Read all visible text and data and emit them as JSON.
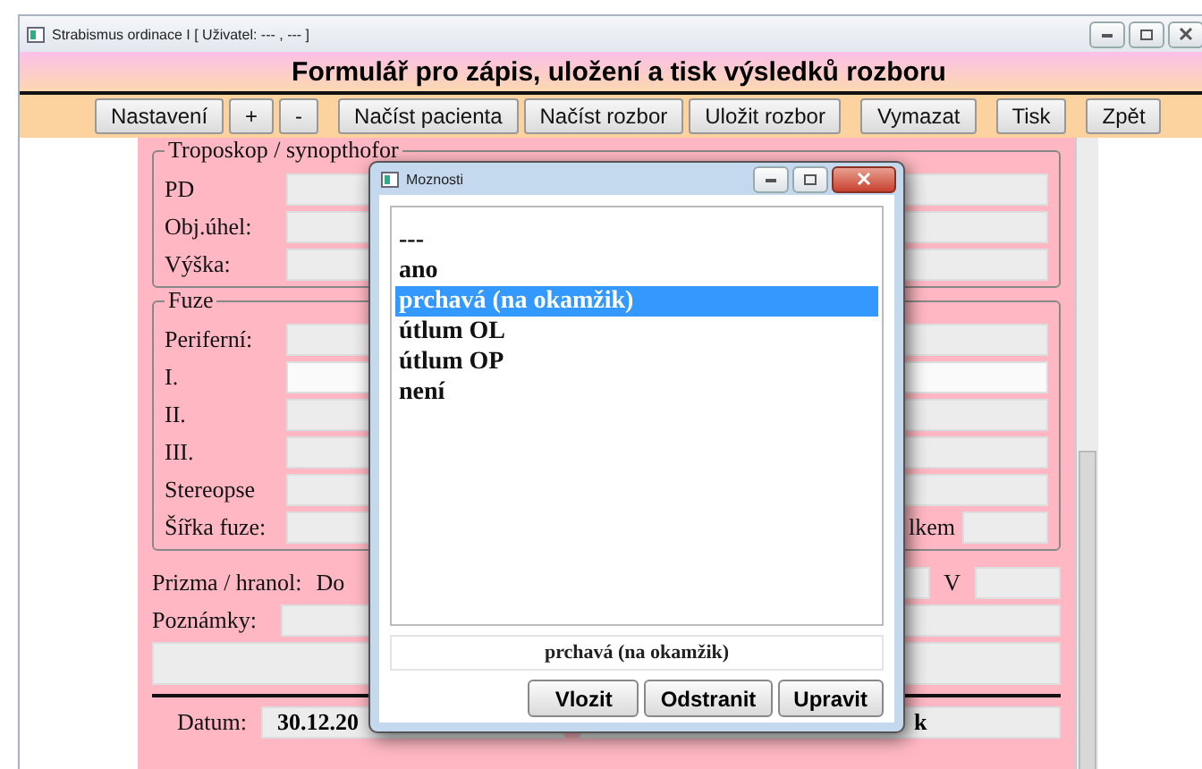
{
  "window": {
    "title": "Strabismus ordinace I [ Uživatel: --- , --- ]"
  },
  "header": {
    "title": "Formulář pro zápis, uložení a tisk výsledků rozboru"
  },
  "toolbar": [
    [
      "Nastavení",
      "+",
      "-"
    ],
    [
      "Načíst pacienta",
      "Načíst rozbor",
      "Uložit rozbor"
    ],
    [
      "Vymazat"
    ],
    [
      "Tisk"
    ],
    [
      "Zpět"
    ]
  ],
  "troposkop": {
    "legend": "Troposkop / synopthofor",
    "rows": [
      {
        "label": "PD",
        "focused": false
      },
      {
        "label": "Obj.úhel:",
        "focused": false
      },
      {
        "label": "Výška:",
        "focused": false
      }
    ]
  },
  "fuze": {
    "legend": "Fuze",
    "rows": [
      {
        "label": "Periferní:",
        "focused": false
      },
      {
        "label": "I.",
        "focused": true
      },
      {
        "label": "II.",
        "focused": false
      },
      {
        "label": "III.",
        "focused": false
      },
      {
        "label": "Stereopse",
        "focused": false
      },
      {
        "label": "Šířka fuze:",
        "focused": false
      }
    ],
    "trailing_label": "lkem"
  },
  "prism": {
    "label": "Prizma / hranol:",
    "label_2": "Do",
    "label_3": "V"
  },
  "notes": {
    "label": "Poznámky:"
  },
  "footer": {
    "date_label": "Datum:",
    "date_value": "30.12.20",
    "text_2": "k"
  },
  "dialog": {
    "title": "Moznosti",
    "options": [
      {
        "label": "---",
        "selected": false
      },
      {
        "label": "ano",
        "selected": false
      },
      {
        "label": "prchavá (na okamžik)",
        "selected": true
      },
      {
        "label": "útlum OL",
        "selected": false
      },
      {
        "label": "útlum OP",
        "selected": false
      },
      {
        "label": "není",
        "selected": false
      }
    ],
    "current": "prchavá (na okamžik)",
    "buttons": [
      "Vlozit",
      "Odstranit",
      "Upravit"
    ]
  }
}
